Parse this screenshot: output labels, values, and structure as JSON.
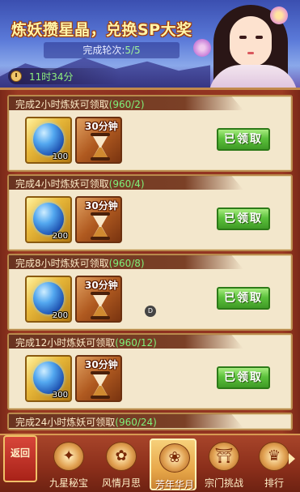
{
  "banner": {
    "title": "炼妖攒星晶，兑换SP大奖",
    "rounds_label": "完成轮次:",
    "rounds_value": "5/5",
    "timer": "11时34分"
  },
  "rewards": [
    {
      "title": "完成2小时炼妖可领取",
      "progress": "(960/2)",
      "stone_qty": "100",
      "time_label": "30分钟",
      "button": "已领取"
    },
    {
      "title": "完成4小时炼妖可领取",
      "progress": "(960/4)",
      "stone_qty": "200",
      "time_label": "30分钟",
      "button": "已领取"
    },
    {
      "title": "完成8小时炼妖可领取",
      "progress": "(960/8)",
      "stone_qty": "200",
      "time_label": "30分钟",
      "button": "已领取"
    },
    {
      "title": "完成12小时炼妖可领取",
      "progress": "(960/12)",
      "stone_qty": "300",
      "time_label": "30分钟",
      "button": "已领取"
    },
    {
      "title": "完成24小时炼妖可领取",
      "progress": "(960/24)"
    }
  ],
  "marker": "D",
  "nav": {
    "back": "返回",
    "tabs": [
      {
        "label": "九星秘宝",
        "icon": "treasure-icon"
      },
      {
        "label": "风情月思",
        "icon": "flower-icon"
      },
      {
        "label": "芳年华月",
        "icon": "dancer-icon"
      },
      {
        "label": "宗门挑战",
        "icon": "temple-icon"
      },
      {
        "label": "排行",
        "icon": "ranking-icon"
      }
    ]
  },
  "colors": {
    "progress_green": "#7ff07a",
    "claim_green": "#5cc23c",
    "panel_red": "#8c3020"
  }
}
